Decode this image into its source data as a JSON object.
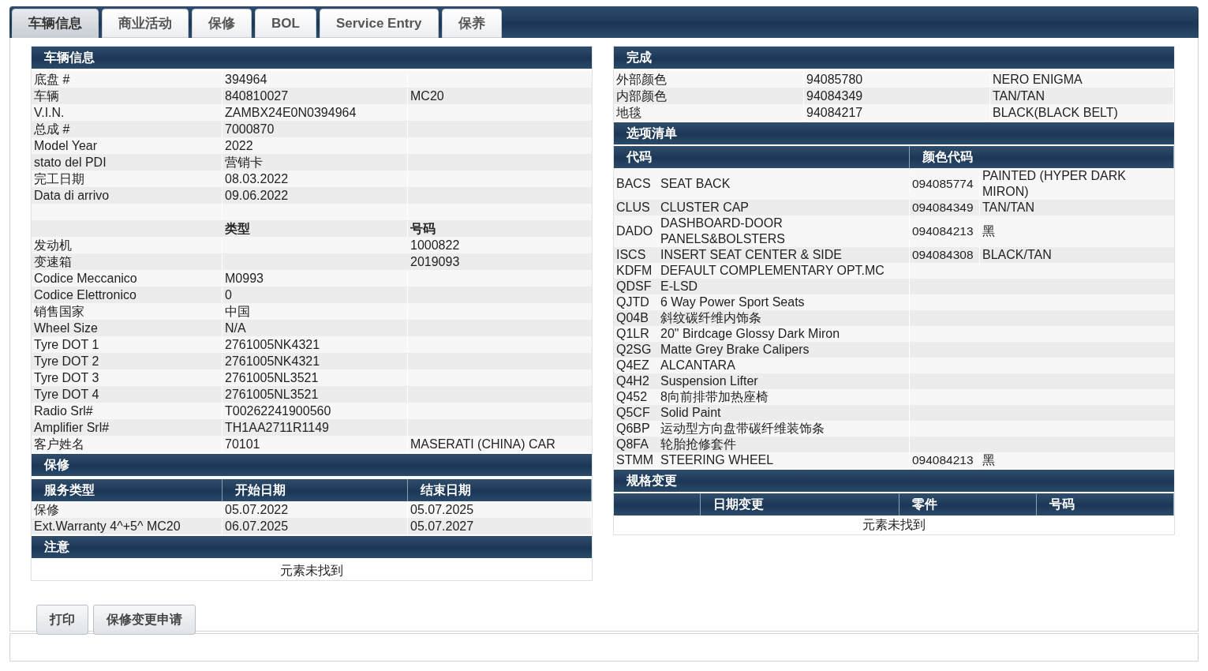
{
  "tabs": [
    {
      "label": "车辆信息",
      "selected": true
    },
    {
      "label": "商业活动",
      "selected": false
    },
    {
      "label": "保修",
      "selected": false
    },
    {
      "label": "BOL",
      "selected": false
    },
    {
      "label": "Service Entry",
      "selected": false
    },
    {
      "label": "保养",
      "selected": false
    }
  ],
  "vehicle_info": {
    "title": "车辆信息",
    "rows": [
      {
        "kind": "data",
        "label": "底盘 #",
        "value": "394964"
      },
      {
        "kind": "data",
        "label": "车辆",
        "value": "840810027",
        "extra": "MC20"
      },
      {
        "kind": "data",
        "label": "V.I.N.",
        "value": "ZAMBX24E0N0394964"
      },
      {
        "kind": "data",
        "label": "总成 #",
        "value": "7000870"
      },
      {
        "kind": "data",
        "label": "Model Year",
        "value": "2022"
      },
      {
        "kind": "data",
        "label": "stato del PDI",
        "value": "营销卡"
      },
      {
        "kind": "data",
        "label": "完工日期",
        "value": "08.03.2022"
      },
      {
        "kind": "data",
        "label": "Data di arrivo",
        "value": "09.06.2022"
      },
      {
        "kind": "blank"
      },
      {
        "kind": "header",
        "value": "类型",
        "extra": "号码"
      },
      {
        "kind": "data",
        "label": "发动机",
        "extra": "1000822"
      },
      {
        "kind": "data",
        "label": "变速箱",
        "extra": "2019093"
      },
      {
        "kind": "data",
        "label": "Codice Meccanico",
        "value": "M0993"
      },
      {
        "kind": "data",
        "label": "Codice Elettronico",
        "value": "0"
      },
      {
        "kind": "data",
        "label": "销售国家",
        "value": "中国"
      },
      {
        "kind": "data",
        "label": "Wheel Size",
        "value": "N/A"
      },
      {
        "kind": "data",
        "label": "Tyre DOT 1",
        "value": "2761005NK4321"
      },
      {
        "kind": "data",
        "label": "Tyre DOT 2",
        "value": "2761005NK4321"
      },
      {
        "kind": "data",
        "label": "Tyre DOT 3",
        "value": "2761005NL3521"
      },
      {
        "kind": "data",
        "label": "Tyre DOT 4",
        "value": "2761005NL3521"
      },
      {
        "kind": "data",
        "label": "Radio Srl#",
        "value": "T00262241900560"
      },
      {
        "kind": "data",
        "label": "Amplifier Srl#",
        "value": "TH1AA2711R1149"
      },
      {
        "kind": "data",
        "label": "客户姓名",
        "value": "70101",
        "extra": "MASERATI (CHINA) CAR"
      }
    ]
  },
  "warranty": {
    "title": "保修",
    "columns": [
      "服务类型",
      "开始日期",
      "结束日期"
    ],
    "rows": [
      {
        "type": "保修",
        "start": "05.07.2022",
        "end": "05.07.2025"
      },
      {
        "type": "Ext.Warranty 4^+5^ MC20",
        "start": "06.07.2025",
        "end": "05.07.2027"
      }
    ]
  },
  "notes": {
    "title": "注意",
    "empty_message": "元素未找到"
  },
  "finish": {
    "title": "完成",
    "rows": [
      {
        "label": "外部颜色",
        "code": "94085780",
        "name": "NERO ENIGMA"
      },
      {
        "label": "内部颜色",
        "code": "94084349",
        "name": "TAN/TAN"
      },
      {
        "label": "地毯",
        "code": "94084217",
        "name": "BLACK(BLACK BELT)"
      }
    ]
  },
  "options": {
    "title": "选项清单",
    "columns": [
      "代码",
      "颜色代码"
    ],
    "rows": [
      {
        "code": "BACS",
        "description": "SEAT BACK",
        "color_code": "094085774",
        "color_name": "PAINTED (HYPER DARK MIRON)"
      },
      {
        "code": "CLUS",
        "description": "CLUSTER CAP",
        "color_code": "094084349",
        "color_name": "TAN/TAN"
      },
      {
        "code": "DADO",
        "description": "DASHBOARD-DOOR PANELS&BOLSTERS",
        "color_code": "094084213",
        "color_name": "黑"
      },
      {
        "code": "ISCS",
        "description": "INSERT SEAT CENTER & SIDE",
        "color_code": "094084308",
        "color_name": "BLACK/TAN"
      },
      {
        "code": "KDFM",
        "description": "DEFAULT COMPLEMENTARY OPT.MC"
      },
      {
        "code": "QDSF",
        "description": "E-LSD"
      },
      {
        "code": "QJTD",
        "description": "6 Way Power Sport Seats"
      },
      {
        "code": "Q04B",
        "description": "斜纹碳纤维内饰条"
      },
      {
        "code": "Q1LR",
        "description": "20\" Birdcage Glossy Dark Miron"
      },
      {
        "code": "Q2SG",
        "description": "Matte Grey Brake Calipers"
      },
      {
        "code": "Q4EZ",
        "description": "ALCANTARA"
      },
      {
        "code": "Q4H2",
        "description": "Suspension Lifter"
      },
      {
        "code": "Q452",
        "description": "8向前排带加热座椅"
      },
      {
        "code": "Q5CF",
        "description": "Solid Paint"
      },
      {
        "code": "Q6BP",
        "description": "运动型方向盘带碳纤维装饰条"
      },
      {
        "code": "Q8FA",
        "description": "轮胎抢修套件"
      },
      {
        "code": "STMM",
        "description": "STEERING WHEEL",
        "color_code": "094084213",
        "color_name": "黑"
      }
    ]
  },
  "spec_changes": {
    "title": "规格变更",
    "columns": [
      "日期变更",
      "零件",
      "号码"
    ],
    "empty_message": "元素未找到"
  },
  "buttons": [
    "打印",
    "保修变更申请"
  ]
}
